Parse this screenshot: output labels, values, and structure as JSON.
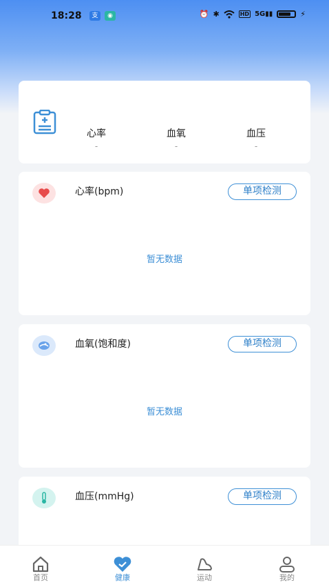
{
  "status_bar": {
    "time": "18:28",
    "icons": [
      "alipay-icon",
      "app-badge-icon",
      "alarm-icon",
      "bluetooth-icon",
      "wifi-icon",
      "hd-icon",
      "5g-signal-icon",
      "battery-icon",
      "charging-icon"
    ],
    "network_hd": "HD",
    "network_5g": "5G"
  },
  "summary": {
    "icon": "clipboard-icon",
    "items": [
      {
        "label": "心率",
        "value": "-"
      },
      {
        "label": "血氧",
        "value": "-"
      },
      {
        "label": "血压",
        "value": "-"
      }
    ]
  },
  "metrics": [
    {
      "title": "心率(bpm)",
      "button": "单项检测",
      "empty_text": "暂无数据",
      "icon": "heart-icon",
      "icon_bg": "#fde2e2",
      "icon_color": "#e74c4c"
    },
    {
      "title": "血氧(饱和度)",
      "button": "单项检测",
      "empty_text": "暂无数据",
      "icon": "blood-oxygen-icon",
      "icon_bg": "#dbe9fb",
      "icon_color": "#4a8de0"
    },
    {
      "title": "血压(mmHg)",
      "button": "单项检测",
      "icon": "thermometer-icon",
      "icon_bg": "#d4f3ef",
      "icon_color": "#2bb6a4"
    }
  ],
  "tabbar": {
    "tabs": [
      {
        "label": "首页",
        "icon": "home-icon",
        "active": false
      },
      {
        "label": "健康",
        "icon": "health-heart-icon",
        "active": true
      },
      {
        "label": "运动",
        "icon": "shoe-icon",
        "active": false
      },
      {
        "label": "我的",
        "icon": "profile-icon",
        "active": false
      }
    ]
  },
  "colors": {
    "accent": "#3d8fd6",
    "header_gradient_top": "#4d8ff2",
    "background": "#f2f4f7"
  }
}
